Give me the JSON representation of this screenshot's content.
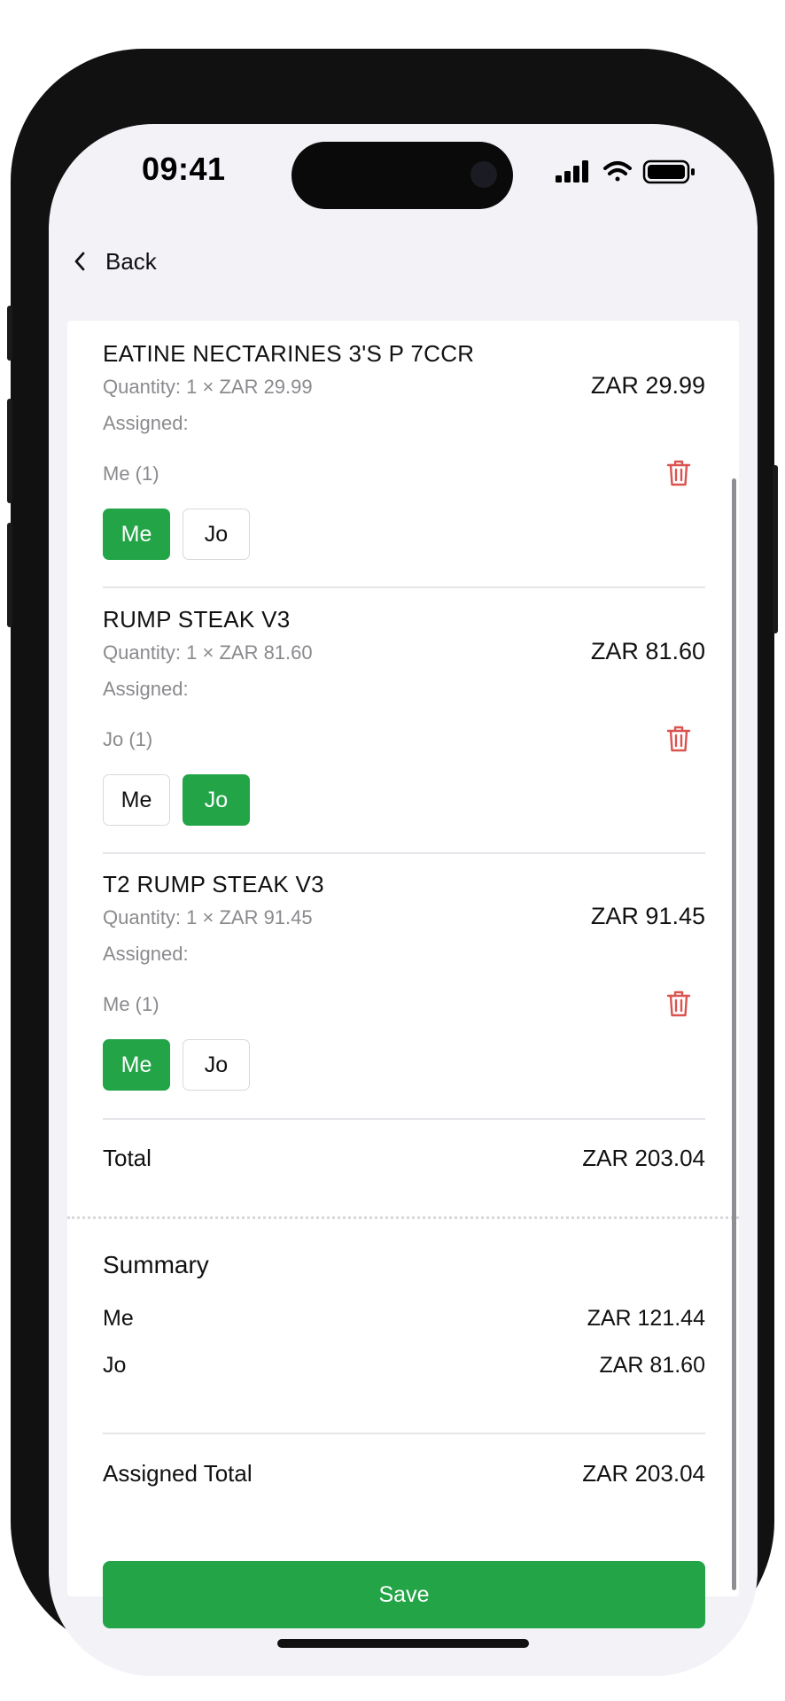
{
  "status_bar": {
    "time": "09:41"
  },
  "nav": {
    "back_label": "Back"
  },
  "items": [
    {
      "name": "EATINE NECTARINES 3'S P 7CCR",
      "quantity": "Quantity: 1 × ZAR 29.99",
      "price": "ZAR 29.99",
      "assigned_label": "Assigned:",
      "assigned_summary": "Me (1)",
      "chips": [
        {
          "label": "Me",
          "selected": true
        },
        {
          "label": "Jo",
          "selected": false
        }
      ]
    },
    {
      "name": "RUMP STEAK V3",
      "quantity": "Quantity: 1 × ZAR 81.60",
      "price": "ZAR 81.60",
      "assigned_label": "Assigned:",
      "assigned_summary": "Jo (1)",
      "chips": [
        {
          "label": "Me",
          "selected": false
        },
        {
          "label": "Jo",
          "selected": true
        }
      ]
    },
    {
      "name": "T2 RUMP STEAK V3",
      "quantity": "Quantity: 1 × ZAR 91.45",
      "price": "ZAR 91.45",
      "assigned_label": "Assigned:",
      "assigned_summary": "Me (1)",
      "chips": [
        {
          "label": "Me",
          "selected": true
        },
        {
          "label": "Jo",
          "selected": false
        }
      ]
    }
  ],
  "total": {
    "label": "Total",
    "value": "ZAR 203.04"
  },
  "summary": {
    "title": "Summary",
    "people": [
      {
        "name": "Me",
        "amount": "ZAR 121.44"
      },
      {
        "name": "Jo",
        "amount": "ZAR 81.60"
      }
    ],
    "assigned_total_label": "Assigned Total",
    "assigned_total_value": "ZAR 203.04"
  },
  "save_label": "Save",
  "colors": {
    "accent": "#22a447",
    "danger": "#d9534f"
  }
}
